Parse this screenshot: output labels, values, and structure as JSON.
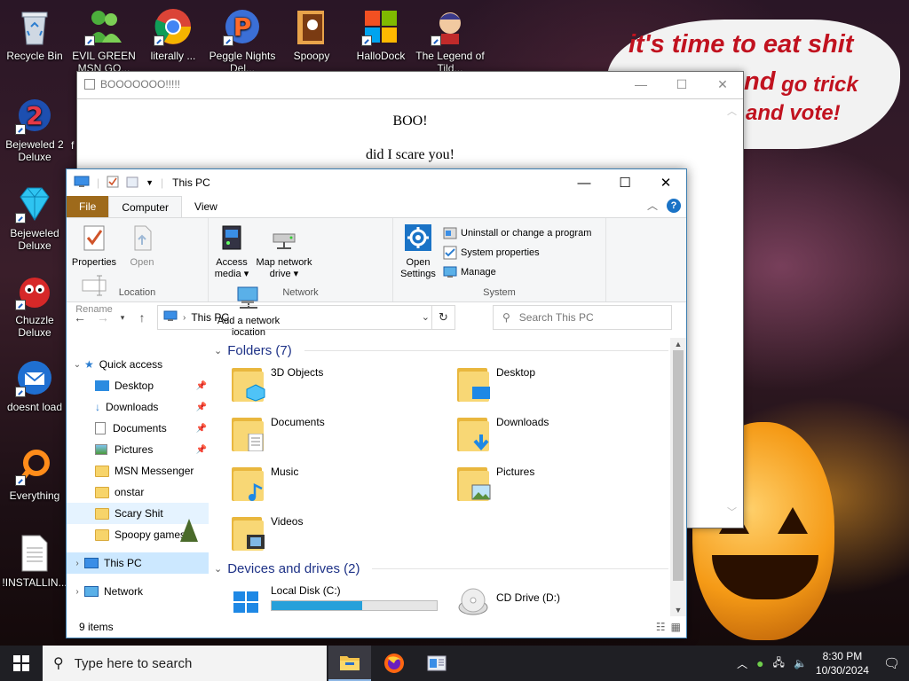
{
  "desktop": {
    "icons": [
      {
        "label": "Recycle Bin"
      },
      {
        "label": "EVIL GREEN MSN GO..."
      },
      {
        "label": "literally ..."
      },
      {
        "label": "Peggle Nights Del..."
      },
      {
        "label": "Spoopy"
      },
      {
        "label": "HalloDock"
      },
      {
        "label": "The Legend of Tild..."
      },
      {
        "label": "Bejeweled 2 Deluxe"
      },
      {
        "label": "Bejeweled Deluxe"
      },
      {
        "label": "Chuzzle Deluxe"
      },
      {
        "label": "doesnt load"
      },
      {
        "label": "Everything"
      },
      {
        "label": "!INSTALLIN..."
      }
    ],
    "partial_label": "f"
  },
  "wallpaper": {
    "line1": "it's time to eat shit",
    "line2": "nd",
    "line2b": "go trick",
    "line3": "and vote!"
  },
  "boo_window": {
    "title": "BOOOOOOO!!!!!",
    "heading": "BOO!",
    "text": "did I scare you!"
  },
  "explorer": {
    "title": "This PC",
    "tabs": {
      "file": "File",
      "computer": "Computer",
      "view": "View"
    },
    "ribbon": {
      "location": {
        "name": "Location",
        "properties": "Properties",
        "open": "Open",
        "rename": "Rename"
      },
      "network": {
        "name": "Network",
        "access_media": "Access media ▾",
        "map_drive": "Map network drive ▾",
        "add_location": "Add a network location"
      },
      "system": {
        "name": "System",
        "open_settings": "Open Settings",
        "uninstall": "Uninstall or change a program",
        "sys_props": "System properties",
        "manage": "Manage"
      }
    },
    "address": {
      "path": "This PC",
      "search_placeholder": "Search This PC"
    },
    "nav": {
      "quick_access": "Quick access",
      "items": [
        "Desktop",
        "Downloads",
        "Documents",
        "Pictures",
        "MSN Messenger",
        "onstar",
        "Scary Shit",
        "Spoopy games"
      ],
      "this_pc": "This PC",
      "network": "Network"
    },
    "folders_header": "Folders (7)",
    "folders": [
      "3D Objects",
      "Desktop",
      "Documents",
      "Downloads",
      "Music",
      "Pictures",
      "Videos"
    ],
    "devices_header": "Devices and drives (2)",
    "drives": [
      {
        "label": "Local Disk (C:)",
        "used_fraction": 0.55
      },
      {
        "label": "CD Drive (D:)"
      }
    ],
    "status": "9 items"
  },
  "taskbar": {
    "search_placeholder": "Type here to search",
    "time": "8:30 PM",
    "date": "10/30/2024"
  }
}
